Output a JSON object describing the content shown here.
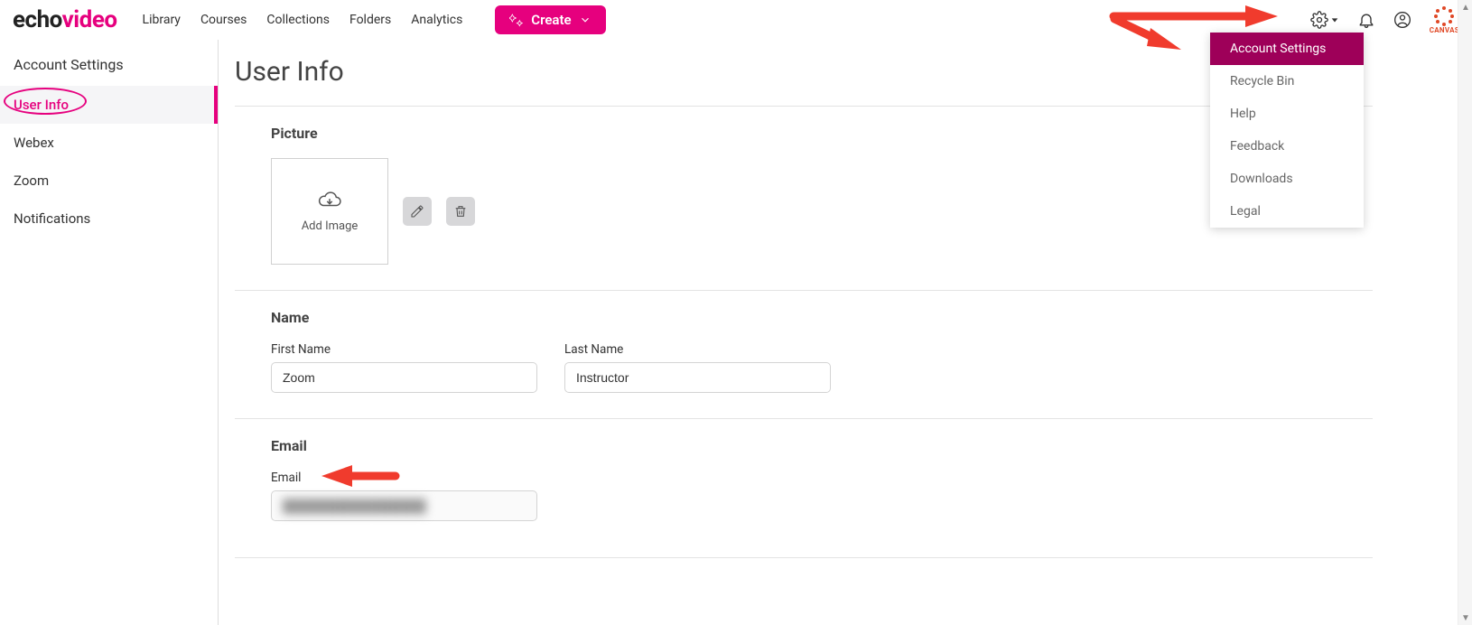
{
  "brand": {
    "part1": "echo",
    "part2": "video"
  },
  "nav": {
    "library": "Library",
    "courses": "Courses",
    "collections": "Collections",
    "folders": "Folders",
    "analytics": "Analytics",
    "create": "Create"
  },
  "canvas_label": "CANVAS",
  "sidebar": {
    "title": "Account Settings",
    "items": [
      {
        "label": "User Info"
      },
      {
        "label": "Webex"
      },
      {
        "label": "Zoom"
      },
      {
        "label": "Notifications"
      }
    ]
  },
  "page": {
    "title": "User Info",
    "picture_heading": "Picture",
    "add_image": "Add Image",
    "name_heading": "Name",
    "first_name_label": "First Name",
    "last_name_label": "Last Name",
    "first_name_value": "Zoom",
    "last_name_value": "Instructor",
    "email_heading": "Email",
    "email_label": "Email",
    "email_value": "████████████████"
  },
  "dropdown": {
    "items": [
      "Account Settings",
      "Recycle Bin",
      "Help",
      "Feedback",
      "Downloads",
      "Legal"
    ]
  }
}
